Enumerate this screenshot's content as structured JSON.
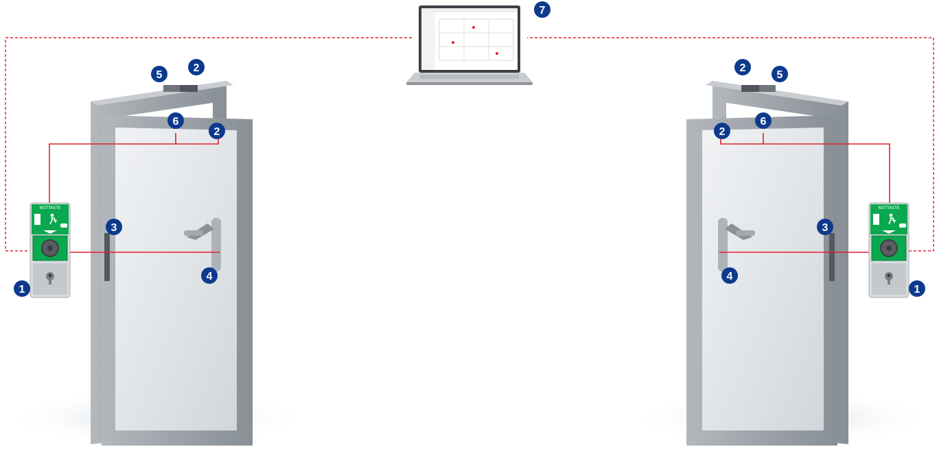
{
  "colors": {
    "marker": "#0d3a8c",
    "wire_solid": "#e0202a",
    "wire_dashed": "#e0202a",
    "panel_green": "#0aa84f",
    "panel_header": "#0aa84f",
    "frame_metal": "#9ea4aa",
    "glass": "#e3e6e9"
  },
  "markers": {
    "m1_left": "1",
    "m2_top_left": "2",
    "m2_mid_left": "2",
    "m3_left": "3",
    "m4_left": "4",
    "m5_left": "5",
    "m6_left": "6",
    "m7_laptop": "7",
    "m1_right": "1",
    "m2_top_right": "2",
    "m2_mid_right": "2",
    "m3_right": "3",
    "m4_right": "4",
    "m5_right": "5",
    "m6_right": "6"
  },
  "panel": {
    "header_left": "NOTTASTE",
    "header_right": "NOTTASTE"
  },
  "icons": {
    "laptop": "laptop-icon",
    "exit": "emergency-exit-icon",
    "key": "key-cylinder-icon"
  }
}
